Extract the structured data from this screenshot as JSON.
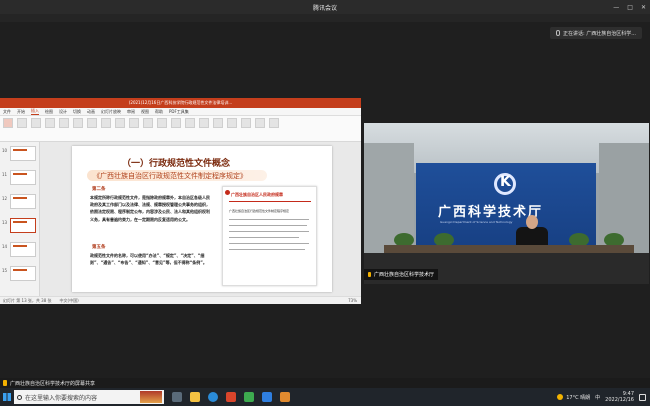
{
  "window": {
    "title": "腾讯会议",
    "controls": [
      "—",
      "□",
      "✕"
    ]
  },
  "speaker_badge": {
    "text": "正在讲话: 广西壮族自治区科学..."
  },
  "ppt": {
    "title": "(2021)12月16日广西科技学院行政规范性文件法律培训...",
    "menu": [
      "文件",
      "开始",
      "插入",
      "绘图",
      "设计",
      "切换",
      "动画",
      "幻灯片放映",
      "审阅",
      "视图",
      "帮助",
      "PDF工具集"
    ],
    "active_menu": "插入",
    "thumbs": [
      "10",
      "11",
      "12",
      "13",
      "14",
      "15"
    ],
    "slide": {
      "heading": "（一）行政规范性文件概念",
      "subtitle": "《广西壮族自治区行政规范性文件制定程序规定》",
      "article2": "第二条",
      "para1": "本规定所称行政规范性文件，是指除政府规章外，本自治区各级人民政府及其工作部门以及法律、法规、规章授权管理公共事务的组织，依照法定权限、程序制定公布，内容涉及公民、法人和其他组织权利义务，具有普遍约束力，在一定期限内反复适用的公文。",
      "article5": "第五条",
      "para2": "政规范性文件的名称，可以使用“办法”、“规定”、“决定”、“细则”、“通告”、“布告”、“通知”、“意见”等，但不得称“条例”。",
      "doc_header": "广西壮族自治区人民政府规章",
      "doc_title": "广西壮族自治区行政规范性文件制定程序规定"
    },
    "status": {
      "slide_no": "幻灯片 第 13 张，共 38 张",
      "lang": "中文(中国)",
      "zoom": "73%"
    }
  },
  "video": {
    "label": "广西壮族自治区科学技术厅",
    "wall_text": "广西科学技术厅",
    "wall_en": "Guangxi Department of Science and Technology"
  },
  "share_bar": {
    "text": "广西壮族自治区科学技术厅的屏幕共享"
  },
  "taskbar": {
    "search_placeholder": "在这里输入你要搜索的内容",
    "weather": "17°C 晴朗",
    "time": "9:47",
    "date": "2022/12/16",
    "lang": "中"
  },
  "colors": {
    "accent_ppt": "#c43e1c",
    "screen_blue": "#1f4f9a",
    "taskbar": "#20252b"
  }
}
